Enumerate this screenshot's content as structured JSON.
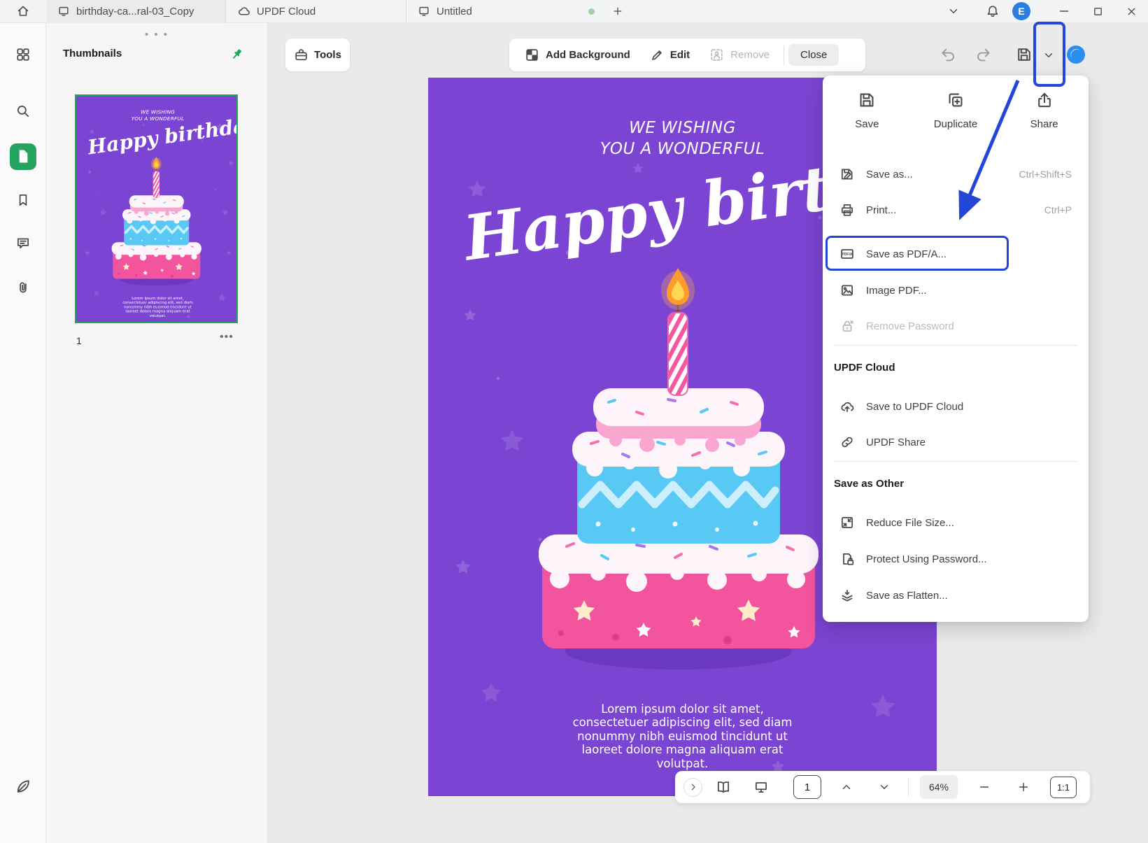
{
  "colors": {
    "accent_green": "#23a55f",
    "annotation_blue": "#2446d8",
    "card_purple": "#7b44d2",
    "avatar_blue": "#2a7de1"
  },
  "titlebar": {
    "tabs": [
      {
        "label": "birthday-ca...ral-03_Copy"
      },
      {
        "label": "UPDF Cloud"
      },
      {
        "label": "Untitled"
      }
    ],
    "new_tab": "+",
    "avatar_initial": "E"
  },
  "thumbnails_panel": {
    "title": "Thumbnails",
    "page_number": "1"
  },
  "toolbar": {
    "tools_label": "Tools",
    "add_background_label": "Add Background",
    "edit_label": "Edit",
    "remove_label": "Remove",
    "close_label": "Close"
  },
  "card": {
    "kicker_line1": "WE WISHING",
    "kicker_line2": "YOU A WONDERFUL",
    "title": "Happy birthday",
    "body": "Lorem ipsum dolor sit amet, consectetuer adipiscing elit, sed diam nonummy nibh euismod tincidunt ut laoreet dolore magna aliquam erat volutpat."
  },
  "menu": {
    "actions": [
      {
        "label": "Save"
      },
      {
        "label": "Duplicate"
      },
      {
        "label": "Share"
      }
    ],
    "items": [
      {
        "label": "Save as...",
        "shortcut": "Ctrl+Shift+S"
      },
      {
        "label": "Print...",
        "shortcut": "Ctrl+P"
      },
      {
        "label": "Save as PDF/A..."
      },
      {
        "label": "Image PDF..."
      },
      {
        "label": "Remove Password"
      }
    ],
    "cloud_section": {
      "header": "UPDF Cloud",
      "items": [
        {
          "label": "Save to UPDF Cloud"
        },
        {
          "label": "UPDF Share"
        }
      ]
    },
    "other_section": {
      "header": "Save as Other",
      "items": [
        {
          "label": "Reduce File Size..."
        },
        {
          "label": "Protect Using Password..."
        },
        {
          "label": "Save as Flatten..."
        }
      ]
    }
  },
  "statusbar": {
    "page": "1",
    "zoom": "64%",
    "actual_size": "1:1"
  }
}
